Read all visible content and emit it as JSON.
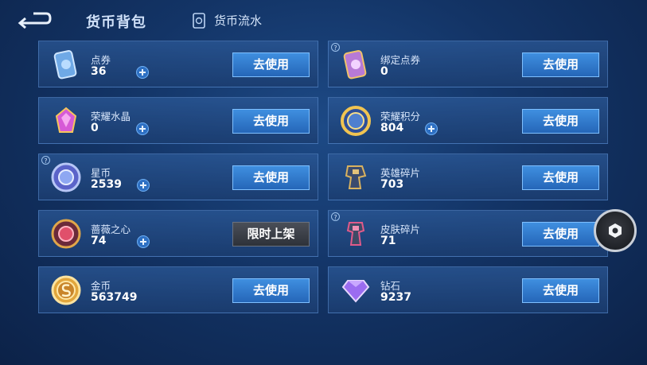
{
  "header": {
    "title": "货币背包",
    "flow_label": "货币流水"
  },
  "currencies": [
    {
      "name": "点券",
      "amount": "36",
      "action": "去使用",
      "icon": "coupon-icon"
    },
    {
      "name": "绑定点券",
      "amount": "0",
      "action": "去使用",
      "icon": "bound-coupon-icon"
    },
    {
      "name": "荣耀水晶",
      "amount": "0",
      "action": "去使用",
      "icon": "glory-crystal-icon"
    },
    {
      "name": "荣耀积分",
      "amount": "804",
      "action": "去使用",
      "icon": "glory-points-icon"
    },
    {
      "name": "星币",
      "amount": "2539",
      "action": "去使用",
      "icon": "star-coin-icon"
    },
    {
      "name": "英雄碎片",
      "amount": "703",
      "action": "去使用",
      "icon": "hero-fragment-icon"
    },
    {
      "name": "蔷薇之心",
      "amount": "74",
      "action": "限时上架",
      "icon": "rose-heart-icon"
    },
    {
      "name": "皮肤碎片",
      "amount": "71",
      "action": "去使用",
      "icon": "skin-fragment-icon"
    },
    {
      "name": "金币",
      "amount": "563749",
      "action": "去使用",
      "icon": "gold-coin-icon"
    },
    {
      "name": "钻石",
      "amount": "9237",
      "action": "去使用",
      "icon": "diamond-icon"
    }
  ],
  "help_mark": "?",
  "colors": {
    "accent_button": "#2f7ad0",
    "card_bg": "#224a86",
    "background": "#133466"
  }
}
